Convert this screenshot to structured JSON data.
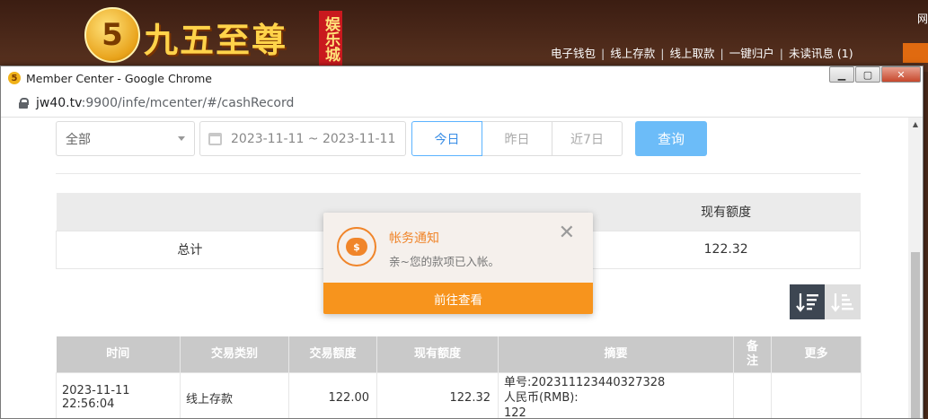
{
  "site": {
    "logo_digit": "5",
    "logo_text": "九五至尊",
    "logo_tag": "娱乐城",
    "nav": [
      "电子钱包",
      "线上存款",
      "线上取款",
      "一键归户",
      "未读讯息 (1)"
    ],
    "nav_separator": "|",
    "corner_text": "网"
  },
  "window": {
    "title": "Member Center - Google Chrome",
    "icon_glyph": "5",
    "url_host": "jw40.tv",
    "url_path": ":9900/infe/mcenter/#/cashRecord",
    "controls": {
      "minimize": "▁",
      "maximize": "▢",
      "close": "✕"
    }
  },
  "filters": {
    "type_select": "全部",
    "date_range": "2023-11-11 ~ 2023-11-11",
    "quick": [
      "今日",
      "昨日",
      "近7日"
    ],
    "active_quick": "今日",
    "query_label": "查询"
  },
  "summary": {
    "header_balance": "现有额度",
    "row_label": "总计",
    "balance": "122.32"
  },
  "records": {
    "headers": [
      "时间",
      "交易类别",
      "交易额度",
      "现有额度",
      "摘要",
      "备注",
      "更多"
    ],
    "rows": [
      {
        "time": "2023-11-11 22:56:04",
        "type": "线上存款",
        "amount": "122.00",
        "balance": "122.32",
        "summary_lines": [
          "单号:202311123440327328",
          "人民币(RMB):",
          "122"
        ],
        "note": "",
        "more": ""
      }
    ]
  },
  "notification": {
    "title": "帐务通知",
    "message": "亲~您的款项已入帐。",
    "button": "前往查看",
    "close_glyph": "✕",
    "icon_glyph": "$"
  },
  "colors": {
    "accent_orange": "#f7941d",
    "query_blue": "#6cbcf8",
    "sort_active": "#3d4652"
  }
}
